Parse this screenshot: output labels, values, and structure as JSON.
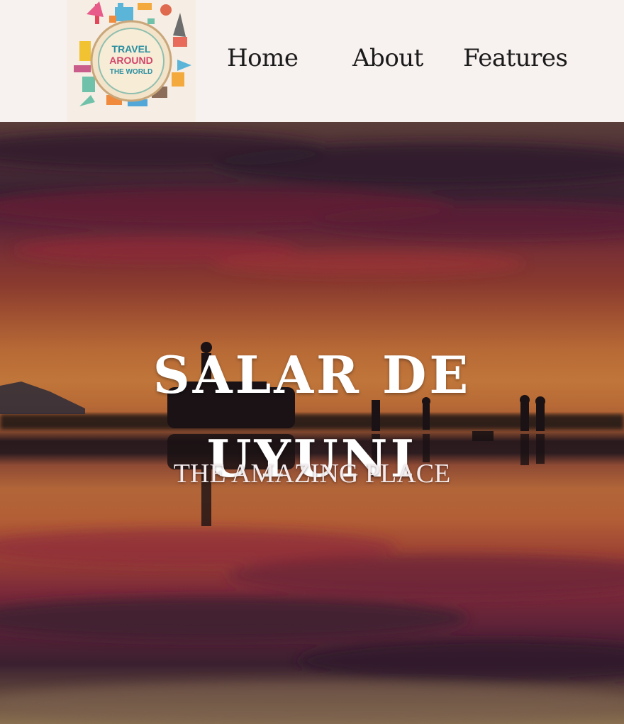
{
  "header": {
    "logo": {
      "text_line1": "TRAVEL",
      "text_line2": "AROUND",
      "text_line3": "THE WORLD",
      "icon": "travel-around-the-world-logo"
    },
    "nav": [
      {
        "label": "Home"
      },
      {
        "label": "About"
      },
      {
        "label": "Features"
      }
    ]
  },
  "hero": {
    "title_line1": "SALAR DE",
    "title_line2": "UYUNI",
    "subtitle": "THE AMAZING PLACE",
    "image": "salar-de-uyuni-sunset-reflection-photo"
  },
  "colors": {
    "header_bg": "#f7f1ef",
    "nav_text": "#1b1b1b",
    "hero_text": "#ffffff"
  }
}
